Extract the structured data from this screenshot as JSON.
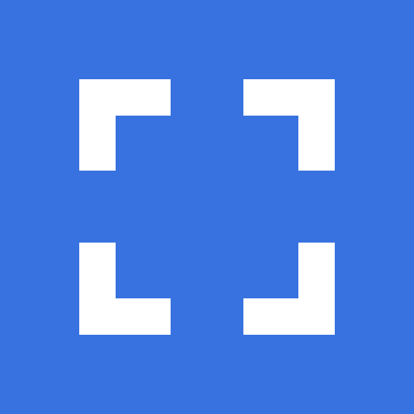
{
  "app": {
    "background_color": "#3872E0",
    "foreground_color": "#FFFFFF",
    "icon": "fullscreen-icon"
  }
}
